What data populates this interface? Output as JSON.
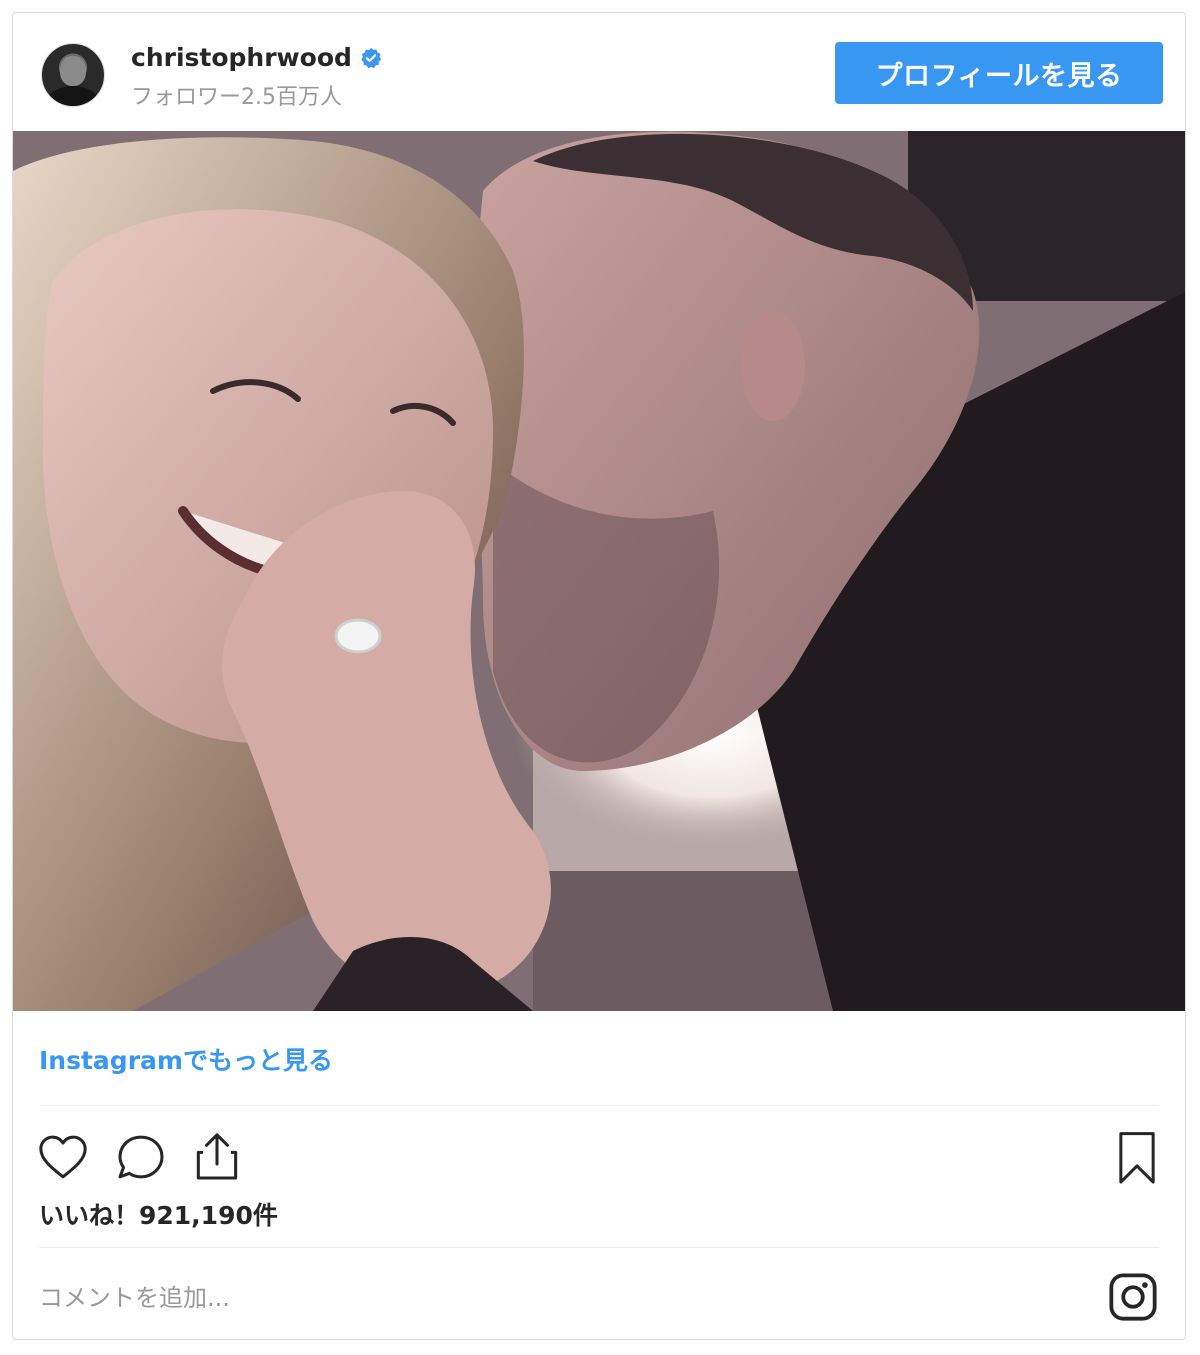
{
  "header": {
    "username": "christophrwood",
    "followers": "フォロワー2.5百万人",
    "profile_button": "プロフィールを見る"
  },
  "photo": {
    "alt": ""
  },
  "more_link": "Instagramでもっと見る",
  "likes": "いいね！921,190件",
  "comment_placeholder": "コメントを追加...",
  "colors": {
    "accent": "#3897f0",
    "text": "#262626",
    "muted": "#999999",
    "border": "#dbdbdb"
  },
  "icons": [
    "heart-icon",
    "comment-icon",
    "share-icon",
    "bookmark-icon",
    "instagram-icon",
    "verified-badge-icon"
  ]
}
